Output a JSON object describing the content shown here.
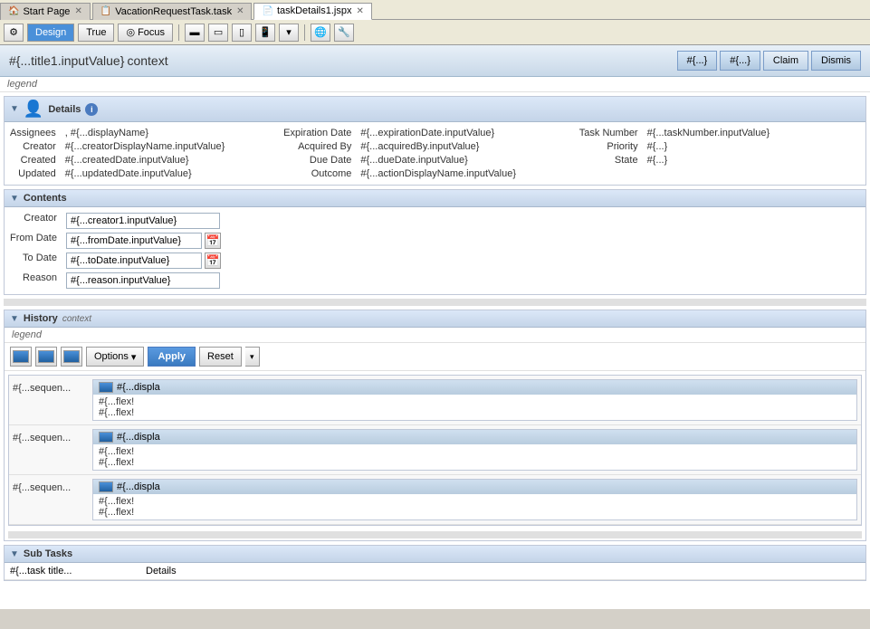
{
  "tabs": [
    {
      "id": "start-page",
      "label": "Start Page",
      "icon": "🏠",
      "active": false
    },
    {
      "id": "vacation-task",
      "label": "VacationRequestTask.task",
      "icon": "📋",
      "active": false
    },
    {
      "id": "task-details",
      "label": "taskDetails1.jspx",
      "icon": "📄",
      "active": true
    }
  ],
  "toolbar": {
    "design_label": "Design",
    "true_label": "True",
    "focus_label": "Focus"
  },
  "page_header": {
    "title": "#{...title1.inputValue}",
    "context": "context",
    "buttons": [
      "#{...}",
      "#{...}",
      "Claim",
      "Dismis"
    ]
  },
  "legend": "legend",
  "details_section": {
    "title": "Details",
    "fields": {
      "assignees_label": "Assignees",
      "assignees_value": ", #{...displayName}",
      "expiration_date_label": "Expiration Date",
      "expiration_date_value": "#{...expirationDate.inputValue}",
      "task_number_label": "Task Number",
      "task_number_value": "#{...taskNumber.inputValue}",
      "creator_label": "Creator",
      "creator_value": "#{...creatorDisplayName.inputValue}",
      "acquired_by_label": "Acquired By",
      "acquired_by_value": "#{...acquiredBy.inputValue}",
      "priority_label": "Priority",
      "priority_value": "#{...}",
      "created_label": "Created",
      "created_value": "#{...createdDate.inputValue}",
      "due_date_label": "Due Date",
      "due_date_value": "#{...dueDate.inputValue}",
      "state_label": "State",
      "state_value": "#{...}",
      "updated_label": "Updated",
      "updated_value": "#{...updatedDate.inputValue}",
      "outcome_label": "Outcome",
      "outcome_value": "#{...actionDisplayName.inputValue}"
    }
  },
  "contents_section": {
    "title": "Contents",
    "fields": {
      "creator_label": "Creator",
      "creator_value": "#{...creator1.inputValue}",
      "from_date_label": "From Date",
      "from_date_value": "#{...fromDate.inputValue}",
      "to_date_label": "To Date",
      "to_date_value": "#{...toDate.inputValue}",
      "reason_label": "Reason",
      "reason_value": "#{...reason.inputValue}"
    }
  },
  "history_section": {
    "title": "History",
    "context": "context",
    "legend": "legend",
    "options_label": "Options",
    "apply_label": "Apply",
    "reset_label": "Reset",
    "rows": [
      {
        "seq": "#{...sequen...",
        "display": "#{...displa",
        "flex1": "#{...flex!",
        "flex2": "#{...flex!"
      },
      {
        "seq": "#{...sequen...",
        "display": "#{...displa",
        "flex1": "#{...flex!",
        "flex2": "#{...flex!"
      },
      {
        "seq": "#{...sequen...",
        "display": "#{...displa",
        "flex1": "#{...flex!",
        "flex2": "#{...flex!"
      }
    ]
  },
  "subtasks_section": {
    "title": "Sub Tasks",
    "col1_header": "#{...task title...",
    "col2_header": "Details"
  }
}
